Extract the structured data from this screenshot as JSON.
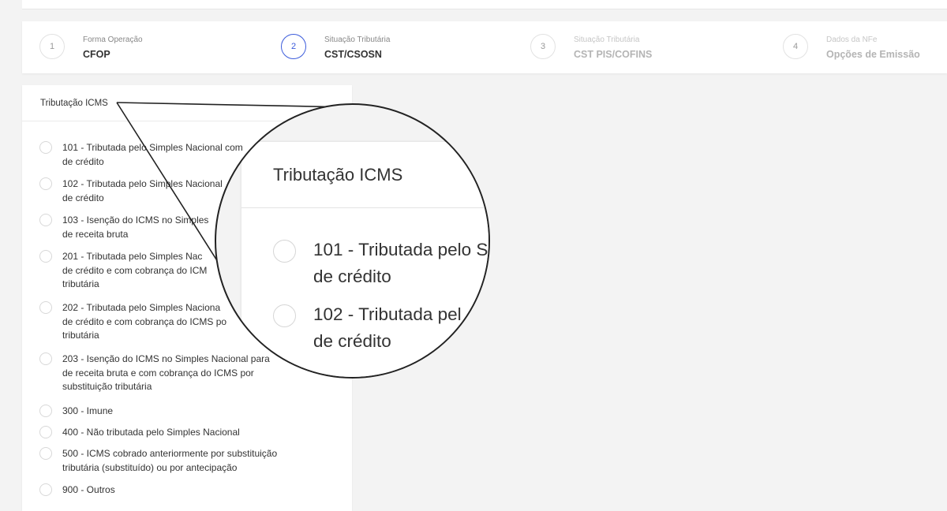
{
  "steps": [
    {
      "number": "1",
      "small": "Forma Operação",
      "big": "CFOP"
    },
    {
      "number": "2",
      "small": "Situação Tributária",
      "big": "CST/CSOSN"
    },
    {
      "number": "3",
      "small": "Situação Tributária",
      "big": "CST PIS/COFINS"
    },
    {
      "number": "4",
      "small": "Dados da NFe",
      "big": "Opções de Emissão"
    }
  ],
  "card": {
    "title": "Tributação ICMS",
    "options": [
      {
        "line1": "101 - Tributada pelo Simples Nacional com",
        "line2": "de crédito"
      },
      {
        "line1": "102 - Tributada pelo Simples Nacional",
        "line2": "de crédito"
      },
      {
        "line1": "103 - Isenção do ICMS no Simples",
        "line2": "de receita bruta"
      },
      {
        "line1": "201 - Tributada pelo Simples Nac",
        "line2": "de crédito e com cobrança do ICM",
        "line3": "tributária"
      },
      {
        "line1": "202 - Tributada pelo Simples Naciona",
        "line2": "de crédito e com cobrança do ICMS po",
        "line3": "tributária"
      },
      {
        "line1": "203 - Isenção do ICMS no Simples Nacional para",
        "line2": "de receita bruta e com cobrança do ICMS por",
        "line3": "substituição tributária"
      },
      {
        "line1": "300 - Imune"
      },
      {
        "line1": "400 - Não tributada pelo Simples Nacional"
      },
      {
        "line1": "500 - ICMS cobrado anteriormente por substituição",
        "line2": "tributária (substituído) ou por antecipação"
      },
      {
        "line1": "900 - Outros"
      }
    ]
  },
  "magnifier": {
    "title": "Tributação ICMS",
    "options": [
      {
        "line1": "101 - Tributada pelo S",
        "line2": "de crédito"
      },
      {
        "line1": "102 - Tributada pel",
        "line2": "de crédito"
      }
    ]
  }
}
